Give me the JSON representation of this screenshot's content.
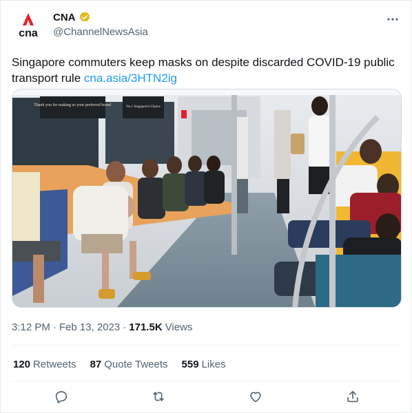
{
  "author": {
    "display_name": "CNA",
    "handle": "@ChannelNewsAsia",
    "logo_text": "cna",
    "verified_icon": "verified-badge-icon"
  },
  "tweet": {
    "text": "Singapore commuters keep masks on despite discarded COVID-19 public transport rule ",
    "link": "cna.asia/3HTN2ig"
  },
  "media": {
    "sign_left": "Thank you for making us your preferred brand",
    "sign_right": "No.1 Singapore's Choice"
  },
  "meta": {
    "time": "3:12 PM",
    "separator": "·",
    "date": "Feb 13, 2023",
    "views_count": "171.5K",
    "views_label": "Views"
  },
  "stats": {
    "retweets_count": "120",
    "retweets_label": "Retweets",
    "quotes_count": "87",
    "quotes_label": "Quote Tweets",
    "likes_count": "559",
    "likes_label": "Likes"
  },
  "colors": {
    "brand_red": "#e4202b",
    "link_blue": "#1d9bf0",
    "verified_gold": "#e2b719",
    "muted_text": "#536471"
  }
}
